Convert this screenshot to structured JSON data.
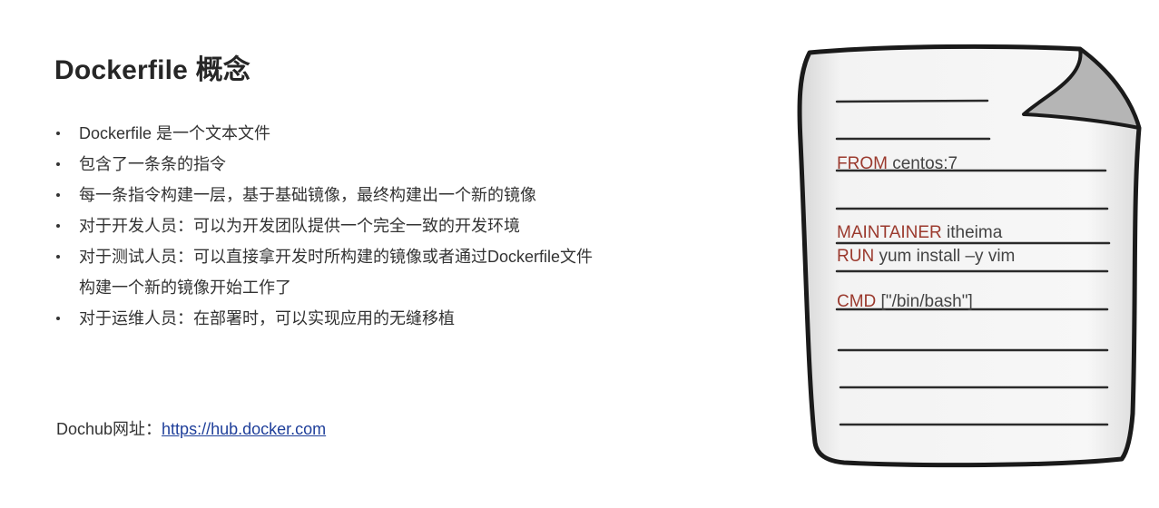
{
  "slide": {
    "title": "Dockerfile 概念",
    "bullets": [
      {
        "text": "Dockerfile 是一个文本文件"
      },
      {
        "text": "包含了一条条的指令"
      },
      {
        "text": "每一条指令构建一层，基于基础镜像，最终构建出一个新的镜像"
      },
      {
        "text": "对于开发人员：可以为开发团队提供一个完全一致的开发环境"
      },
      {
        "text": "对于测试人员：可以直接拿开发时所构建的镜像或者通过Dockerfile文件",
        "cont": "构建一个新的镜像开始工作了"
      },
      {
        "text": "对于运维人员：在部署时，可以实现应用的无缝移植"
      }
    ],
    "dochub": {
      "label": "Dochub网址：",
      "link": "https://hub.docker.com"
    }
  },
  "document_art": {
    "lines": [
      {
        "keyword": "FROM",
        "value": " centos:7"
      },
      {
        "keyword": "MAINTAINER",
        "value": "  itheima"
      },
      {
        "keyword": "RUN",
        "value": " yum install –y vim"
      },
      {
        "keyword": "CMD",
        "value": " [\"/bin/bash\"]"
      }
    ],
    "colors": {
      "keyword": "#9b3a2e",
      "text": "#444444",
      "paper_edge": "#1a1a1a",
      "fold": "#b3b3b3"
    }
  }
}
